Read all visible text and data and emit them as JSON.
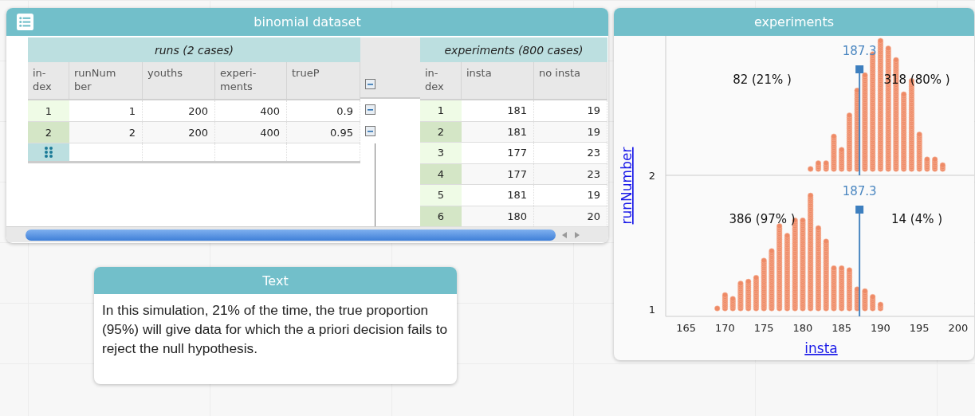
{
  "table": {
    "title": "binomial dataset",
    "parent": {
      "title": "runs (2 cases)",
      "columns": [
        "in-\ndex",
        "runNum\nber",
        "youths",
        "experi-\nments",
        "trueP"
      ],
      "rows": [
        {
          "index": "1",
          "cells": [
            "1",
            "200",
            "400",
            "0.9"
          ]
        },
        {
          "index": "2",
          "cells": [
            "2",
            "200",
            "400",
            "0.95"
          ]
        }
      ]
    },
    "child": {
      "title": "experiments (800 cases)",
      "columns": [
        "in-\ndex",
        "insta",
        "no insta"
      ],
      "rows": [
        {
          "index": "1",
          "cells": [
            "181",
            "19"
          ]
        },
        {
          "index": "2",
          "cells": [
            "181",
            "19"
          ]
        },
        {
          "index": "3",
          "cells": [
            "177",
            "23"
          ]
        },
        {
          "index": "4",
          "cells": [
            "177",
            "23"
          ]
        },
        {
          "index": "5",
          "cells": [
            "181",
            "19"
          ]
        },
        {
          "index": "6",
          "cells": [
            "180",
            "20"
          ]
        }
      ]
    }
  },
  "graph": {
    "title": "experiments",
    "y_axis": {
      "label": "runNumber",
      "ticks": [
        "2",
        "1"
      ]
    },
    "x_axis": {
      "label": "insta",
      "ticks": [
        "165",
        "170",
        "175",
        "180",
        "185",
        "190",
        "195",
        "200"
      ]
    },
    "panels": [
      {
        "mean": "187.3",
        "left_count": "82 (21% )",
        "right_count": "318 (80% )"
      },
      {
        "mean": "187.3",
        "left_count": "386 (97% )",
        "right_count": "14 (4% )"
      }
    ]
  },
  "text_box": {
    "title": "Text",
    "body": "In this simulation, 21% of the time, the true proportion (95%) will give data for which the a priori decision fails to reject the null hypothesis."
  }
}
